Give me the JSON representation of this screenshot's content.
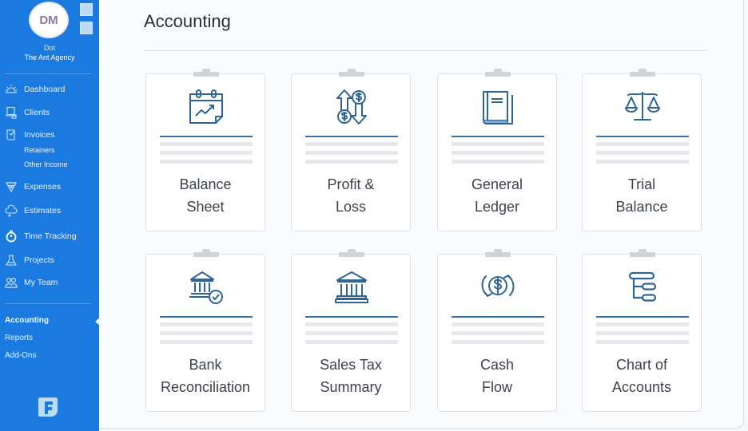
{
  "user": {
    "initials": "DM",
    "name": "Dot",
    "company": "The Ant Agency"
  },
  "sidebar": {
    "nav": [
      {
        "label": "Dashboard",
        "icon": "sun-icon"
      },
      {
        "label": "Clients",
        "icon": "clients-icon"
      },
      {
        "label": "Invoices",
        "icon": "invoice-icon"
      },
      {
        "label": "Expenses",
        "icon": "expenses-icon"
      },
      {
        "label": "Estimates",
        "icon": "estimates-icon"
      },
      {
        "label": "Time Tracking",
        "icon": "stopwatch-icon"
      },
      {
        "label": "Projects",
        "icon": "flask-icon"
      },
      {
        "label": "My Team",
        "icon": "team-icon"
      }
    ],
    "invoice_sub": [
      "Retainers",
      "Other Income"
    ],
    "secondary": [
      {
        "label": "Accounting",
        "active": true
      },
      {
        "label": "Reports",
        "active": false
      },
      {
        "label": "Add-Ons",
        "active": false
      }
    ],
    "logo": "F"
  },
  "main": {
    "title": "Accounting",
    "cards": [
      {
        "line1": "Balance",
        "line2": "Sheet",
        "icon": "calendar-chart-icon"
      },
      {
        "line1": "Profit &",
        "line2": "Loss",
        "icon": "money-up-down-icon"
      },
      {
        "line1": "General",
        "line2": "Ledger",
        "icon": "ledger-book-icon"
      },
      {
        "line1": "Trial",
        "line2": "Balance",
        "icon": "scales-icon"
      },
      {
        "line1": "Bank",
        "line2": "Reconciliation",
        "icon": "bank-check-icon"
      },
      {
        "line1": "Sales Tax",
        "line2": "Summary",
        "icon": "bank-icon"
      },
      {
        "line1": "Cash",
        "line2": "Flow",
        "icon": "cash-cycle-icon"
      },
      {
        "line1": "Chart of",
        "line2": "Accounts",
        "icon": "account-tree-icon"
      }
    ]
  },
  "colors": {
    "sidebar": "#1a7ae0",
    "icon": "#2f6596",
    "accent_rule": "#3a73a8"
  }
}
